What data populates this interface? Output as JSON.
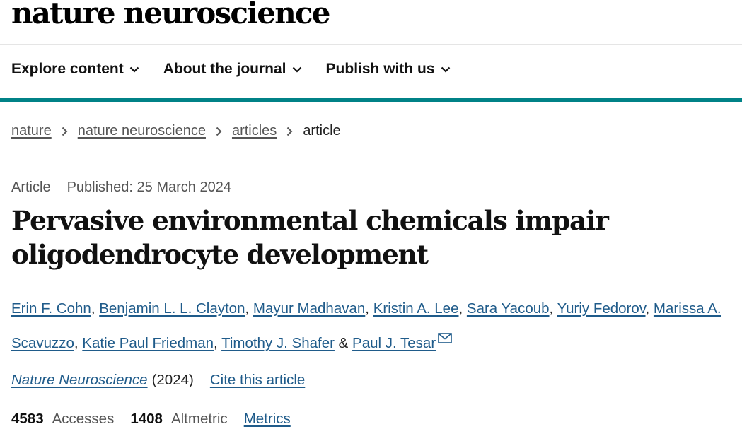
{
  "site": {
    "logo": "nature neuroscience"
  },
  "nav": {
    "items": [
      {
        "label": "Explore content"
      },
      {
        "label": "About the journal"
      },
      {
        "label": "Publish with us"
      }
    ]
  },
  "breadcrumb": {
    "items": [
      {
        "label": "nature"
      },
      {
        "label": "nature neuroscience"
      },
      {
        "label": "articles"
      }
    ],
    "current": "article"
  },
  "article": {
    "type": "Article",
    "published": "Published: 25 March 2024",
    "title": "Pervasive environmental chemicals impair oligodendrocyte development",
    "authors": [
      "Erin F. Cohn",
      "Benjamin L. L. Clayton",
      "Mayur Madhavan",
      "Kristin A. Lee",
      "Sara Yacoub",
      "Yuriy Fedorov",
      "Marissa A. Scavuzzo",
      "Katie Paul Friedman",
      "Timothy J. Shafer",
      "Paul J. Tesar"
    ],
    "author_separator": ", ",
    "last_author_separator": " & ",
    "journal": "Nature Neuroscience",
    "year": "(2024)",
    "cite_label": "Cite this article"
  },
  "metrics": {
    "accesses_value": "4583",
    "accesses_label": "Accesses",
    "altmetric_value": "1408",
    "altmetric_label": "Altmetric",
    "metrics_link": "Metrics"
  },
  "icons": {
    "chevron": "chevron-down-icon",
    "breadcrumb_sep": "chevron-right-icon",
    "corresponding": "mail-icon"
  },
  "colors": {
    "accent": "#008287",
    "link": "#1f5b8a"
  }
}
